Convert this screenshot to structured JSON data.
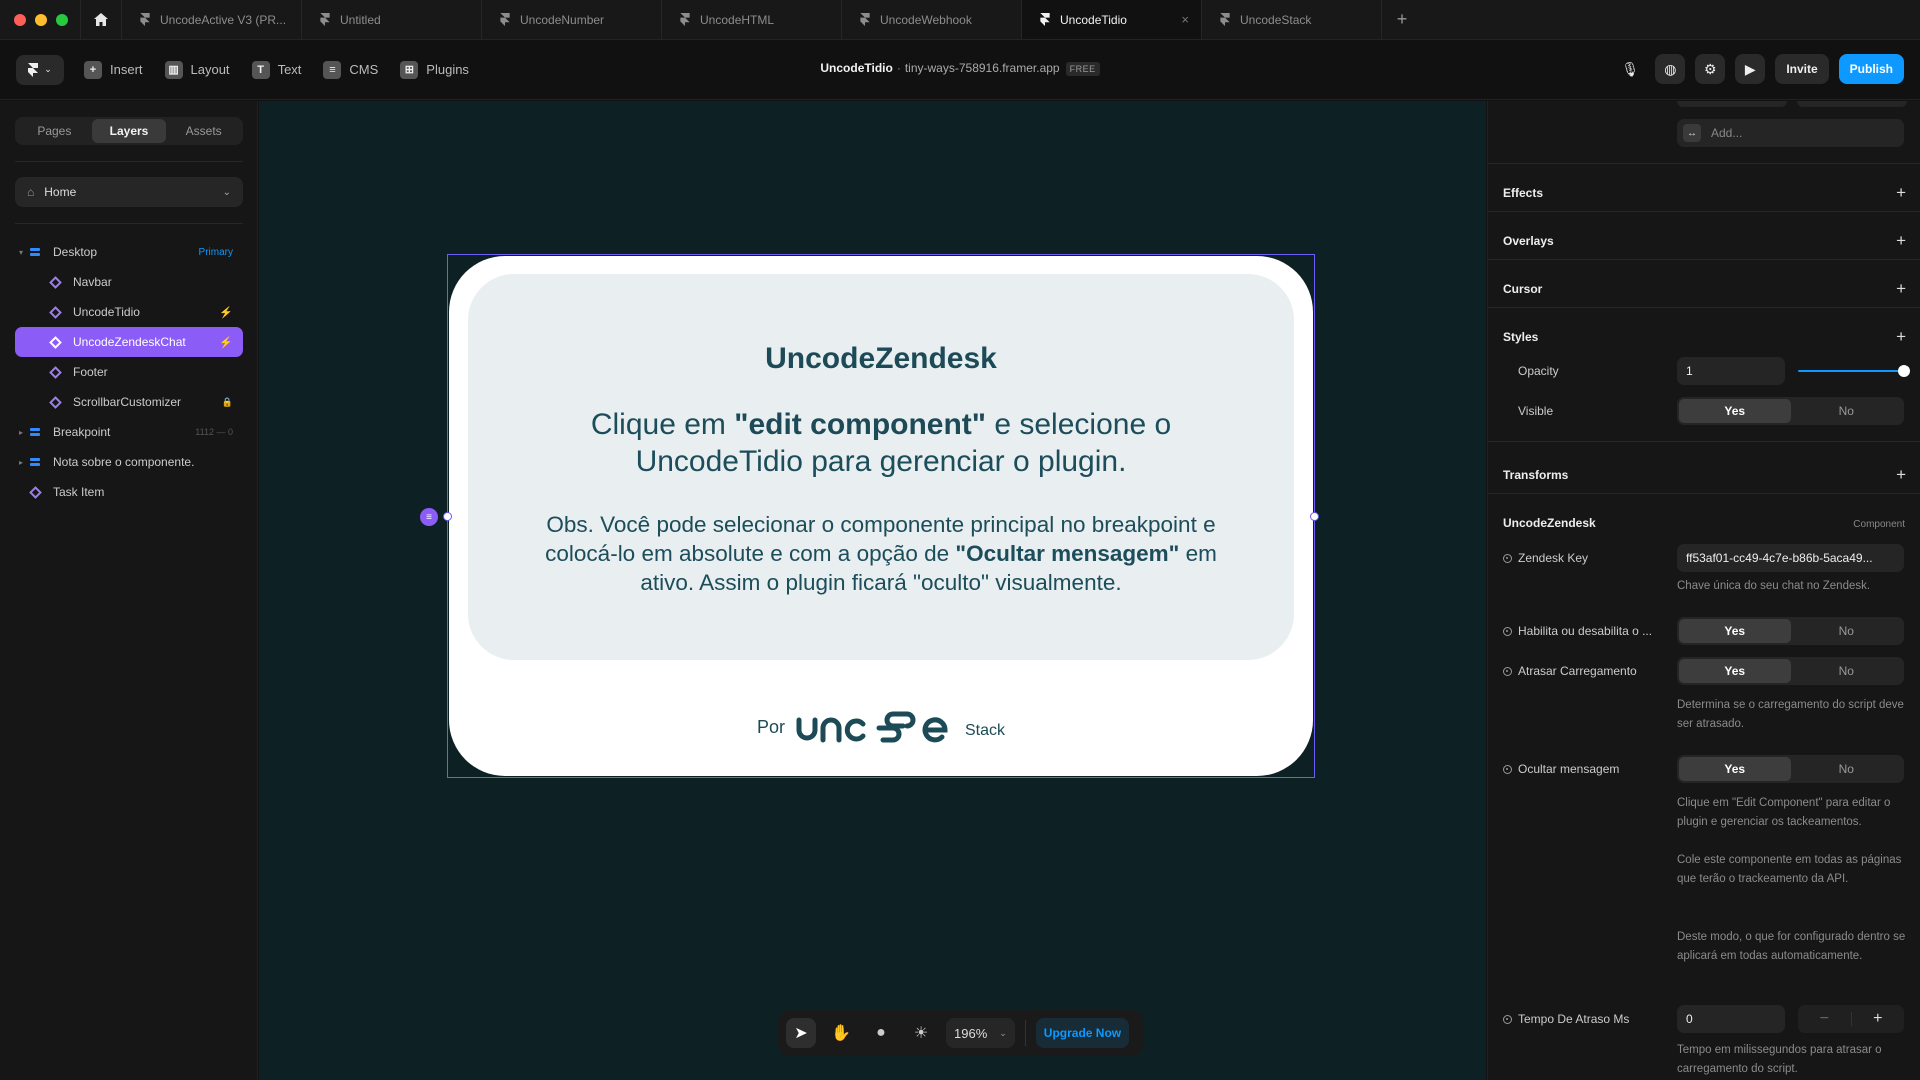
{
  "window": {
    "traffic_colors": [
      "#ff5f57",
      "#febc2e",
      "#28c840"
    ]
  },
  "tabs": [
    {
      "label": "UncodeActive V3 (PR...",
      "active": false
    },
    {
      "label": "Untitled",
      "active": false
    },
    {
      "label": "UncodeNumber",
      "active": false
    },
    {
      "label": "UncodeHTML",
      "active": false
    },
    {
      "label": "UncodeWebhook",
      "active": false
    },
    {
      "label": "UncodeTidio",
      "active": true,
      "close": "×"
    },
    {
      "label": "UncodeStack",
      "active": false
    }
  ],
  "new_tab": "+",
  "toolbar": {
    "insert": "Insert",
    "layout": "Layout",
    "text": "Text",
    "cms": "CMS",
    "plugins": "Plugins",
    "project_name": "UncodeTidio",
    "separator": "·",
    "domain": "tiny-ways-758916.framer.app",
    "plan_badge": "FREE",
    "invite": "Invite",
    "publish": "Publish"
  },
  "left_panel": {
    "tabs": [
      "Pages",
      "Layers",
      "Assets"
    ],
    "active_tab": "Layers",
    "page": "Home",
    "layers": [
      {
        "name": "Desktop",
        "tag": "Primary"
      },
      {
        "name": "Navbar"
      },
      {
        "name": "UncodeTidio",
        "flag": "⚡"
      },
      {
        "name": "UncodeZendeskChat",
        "flag": "⚡",
        "selected": true
      },
      {
        "name": "Footer"
      },
      {
        "name": "ScrollbarCustomizer",
        "flag": "🔒"
      },
      {
        "name": "Breakpoint",
        "dim": "1112 — 0"
      },
      {
        "name": "Nota sobre o componente."
      },
      {
        "name": "Task Item"
      }
    ]
  },
  "canvas": {
    "background": "#0d2125",
    "selection_color": "#6d5cf5",
    "card": {
      "title": "UncodeZendesk",
      "body_pre": "Clique em ",
      "body_bold": "\"edit component\"",
      "body_post": " e selecione o UncodeTidio para gerenciar o plugin.",
      "obs_pre": "Obs. Você pode selecionar o componente principal no breakpoint e colocá-lo em absolute e com a opção de ",
      "obs_bold": "\"Ocultar mensagem\"",
      "obs_post": " em ativo. Assim o plugin ficará \"oculto\" visualmente.",
      "footer_prefix": "Por",
      "footer_suffix": "Stack",
      "logo_text": "uncode"
    },
    "tools": {
      "zoom": "196%",
      "upgrade": "Upgrade Now"
    }
  },
  "right_panel": {
    "add_placeholder": "Add...",
    "sections": {
      "effects": "Effects",
      "overlays": "Overlays",
      "cursor": "Cursor",
      "styles": "Styles",
      "transforms": "Transforms"
    },
    "styles": {
      "opacity_label": "Opacity",
      "opacity_value": "1",
      "opacity_fraction": 1.0,
      "visible_label": "Visible",
      "yes": "Yes",
      "no": "No"
    },
    "component": {
      "title": "UncodeZendesk",
      "tag": "Component",
      "zendesk_key_label": "Zendesk Key",
      "zendesk_key_value": "ff53af01-cc49-4c7e-b86b-5aca49...",
      "zendesk_key_help": "Chave única do seu chat no Zendesk.",
      "habilita_label": "Habilita ou desabilita o ...",
      "atrasar_label": "Atrasar Carregamento",
      "atrasar_help": "Determina se o carregamento do script deve ser atrasado.",
      "ocultar_label": "Ocultar mensagem",
      "ocultar_help_1": "Clique em \"Edit Component\" para editar o plugin e gerenciar os tackeamentos.",
      "ocultar_help_2": "Cole este componente em todas as páginas que terão o trackeamento da API.",
      "ocultar_help_3": "Deste modo, o que for configurado dentro se aplicará em todas automaticamente.",
      "tempo_label": "Tempo De Atraso Ms",
      "tempo_value": "0",
      "stepper_minus": "−",
      "stepper_plus": "+",
      "tempo_help": "Tempo em milissegundos para atrasar o carregamento do script."
    }
  }
}
